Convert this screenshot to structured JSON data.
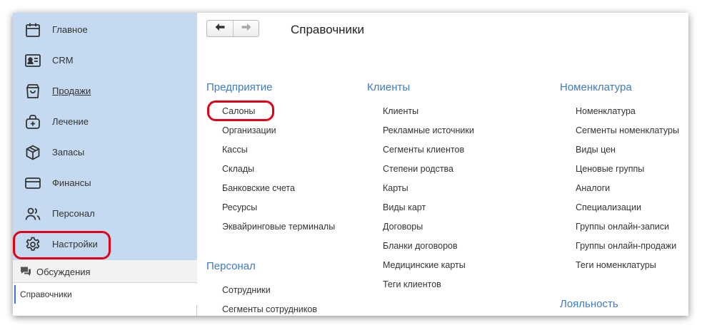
{
  "sidebar": {
    "items": [
      {
        "label": "Главное",
        "icon": "calendar-icon"
      },
      {
        "label": "CRM",
        "icon": "contact-card-icon"
      },
      {
        "label": "Продажи",
        "icon": "shopping-bag-icon"
      },
      {
        "label": "Лечение",
        "icon": "medical-kit-icon"
      },
      {
        "label": "Запасы",
        "icon": "box-icon"
      },
      {
        "label": "Финансы",
        "icon": "credit-card-icon"
      },
      {
        "label": "Персонал",
        "icon": "people-icon"
      },
      {
        "label": "Настройки",
        "icon": "gear-icon"
      }
    ],
    "discussions": "Обсуждения",
    "open_tab": "Справочники"
  },
  "header": {
    "title": "Справочники",
    "back_icon": "arrow-left-icon",
    "forward_icon": "arrow-right-icon"
  },
  "groups": {
    "enterprise": {
      "title": "Предприятие",
      "links": [
        "Салоны",
        "Организации",
        "Кассы",
        "Склады",
        "Банковские счета",
        "Ресурсы",
        "Эквайринговые терминалы"
      ]
    },
    "staff": {
      "title": "Персонал",
      "links": [
        "Сотрудники",
        "Сегменты сотрудников"
      ]
    },
    "clients": {
      "title": "Клиенты",
      "links": [
        "Клиенты",
        "Рекламные источники",
        "Сегменты клиентов",
        "Степени родства",
        "Карты",
        "Виды карт",
        "Договоры",
        "Бланки договоров",
        "Медицинские карты",
        "Теги клиентов"
      ]
    },
    "nomenclature": {
      "title": "Номенклатура",
      "links": [
        "Номенклатура",
        "Сегменты номенклатуры",
        "Виды цен",
        "Ценовые группы",
        "Аналоги",
        "Специализации",
        "Группы онлайн-записи",
        "Группы онлайн-продажи",
        "Теги номенклатуры"
      ]
    },
    "loyalty": {
      "title": "Лояльность"
    }
  },
  "colors": {
    "sidebar_bg": "#c5d9f1",
    "group_title": "#3d7bc4",
    "highlight": "#e1001a"
  }
}
